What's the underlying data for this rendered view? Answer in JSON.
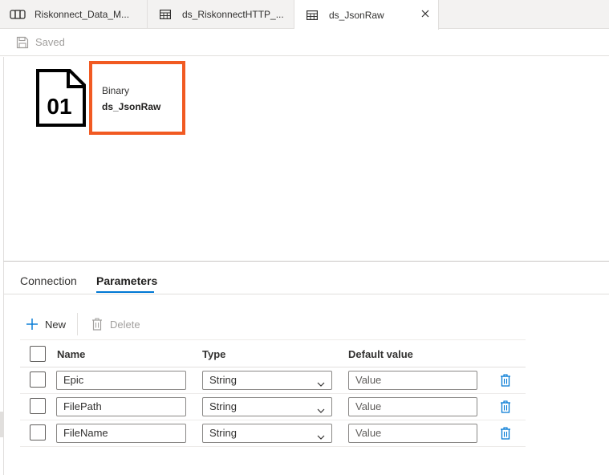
{
  "tabs": [
    {
      "label": "Riskonnect_Data_M...",
      "icon": "pipeline-icon",
      "active": false
    },
    {
      "label": "ds_RiskonnectHTTP_...",
      "icon": "table-icon",
      "active": false
    },
    {
      "label": "ds_JsonRaw",
      "icon": "table-icon",
      "active": true
    }
  ],
  "toolbar": {
    "saved_label": "Saved"
  },
  "dataset": {
    "icon_text": "01",
    "type": "Binary",
    "name": "ds_JsonRaw"
  },
  "panel_tabs": [
    {
      "label": "Connection",
      "active": false
    },
    {
      "label": "Parameters",
      "active": true
    }
  ],
  "actions": {
    "new_label": "New",
    "delete_label": "Delete"
  },
  "grid": {
    "headers": {
      "name": "Name",
      "type": "Type",
      "default": "Default value"
    },
    "rows": [
      {
        "name": "Epic",
        "type": "String",
        "default_placeholder": "Value"
      },
      {
        "name": "FilePath",
        "type": "String",
        "default_placeholder": "Value"
      },
      {
        "name": "FileName",
        "type": "String",
        "default_placeholder": "Value"
      }
    ]
  },
  "colors": {
    "accent": "#0078d4",
    "highlight": "#f15a22",
    "trash": "#0078d4"
  }
}
